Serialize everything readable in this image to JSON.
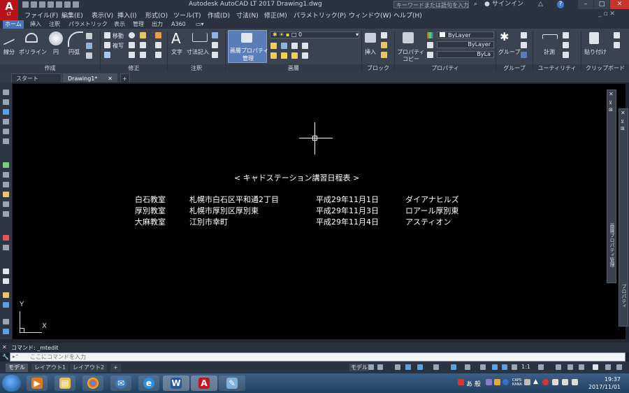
{
  "app": {
    "logo_text": "A",
    "logo_sub": "LT",
    "title": "Autodesk AutoCAD LT 2017    Drawing1.dwg",
    "search_placeholder": "キーワードまたは語句を入力",
    "signin": "サインイン",
    "help_symbol": "?"
  },
  "menubar": [
    "ファイル(F)",
    "編集(E)",
    "表示(V)",
    "挿入(I)",
    "形式(O)",
    "ツール(T)",
    "作成(D)",
    "寸法(N)",
    "修正(M)",
    "パラメトリック(P)",
    "ウィンドウ(W)",
    "ヘルプ(H)"
  ],
  "ribbon_tabs": [
    "ホーム",
    "挿入",
    "注釈",
    "パラメトリック",
    "表示",
    "管理",
    "出力",
    "A360"
  ],
  "ribbon": {
    "draw_tools": [
      "線分",
      "ポリライン",
      "円",
      "円弧"
    ],
    "modify_tools": [
      "移動",
      "複写"
    ],
    "annotation_tools": [
      "文字",
      "寸法記入"
    ],
    "layer_props": [
      "画層プロパティ",
      "管理"
    ],
    "layer_value": "0",
    "block_tool": "挿入",
    "prop_copy": [
      "プロパティ",
      "コピー"
    ],
    "bylayer": [
      "ByLayer",
      "ByLayer",
      "ByLa"
    ],
    "group_tool": "グループ",
    "measure_tool": "計測",
    "paste_tool": "貼り付け",
    "panels": [
      "作成",
      "修正",
      "注釈",
      "画層",
      "ブロック",
      "プロパティ",
      "グループ",
      "ユーティリティ",
      "クリップボード"
    ]
  },
  "file_tabs": [
    "スタート",
    "Drawing1*"
  ],
  "drawing": {
    "heading": "<  キャドステーション講習日程表  >",
    "rows": [
      {
        "room": "白石教室",
        "address": "札幌市白石区平和通2丁目",
        "date": "平成29年11月1日",
        "venue": "ダイアナヒルズ"
      },
      {
        "room": "厚別教室",
        "address": "札幌市厚別区厚別東",
        "date": "平成29年11月3日",
        "venue": "ロアール厚別東"
      },
      {
        "room": "大麻教室",
        "address": "江別市幸町",
        "date": "平成29年11月4日",
        "venue": "アスティオン"
      }
    ],
    "ucs_x": "X",
    "ucs_y": "Y"
  },
  "palettes": [
    "画層プロパティ管理",
    "プロパティ"
  ],
  "command": {
    "history": "コマンド:  _mtedit",
    "placeholder": "ここにコマンドを入力"
  },
  "layout_tabs": [
    "モデル",
    "レイアウト1",
    "レイアウト2"
  ],
  "status": {
    "model_label": "モデル",
    "scale": "1:1"
  },
  "taskbar": {
    "ime": "あ 般",
    "caps": "CAPS KANA",
    "time": "19:37",
    "date": "2017/11/01"
  }
}
